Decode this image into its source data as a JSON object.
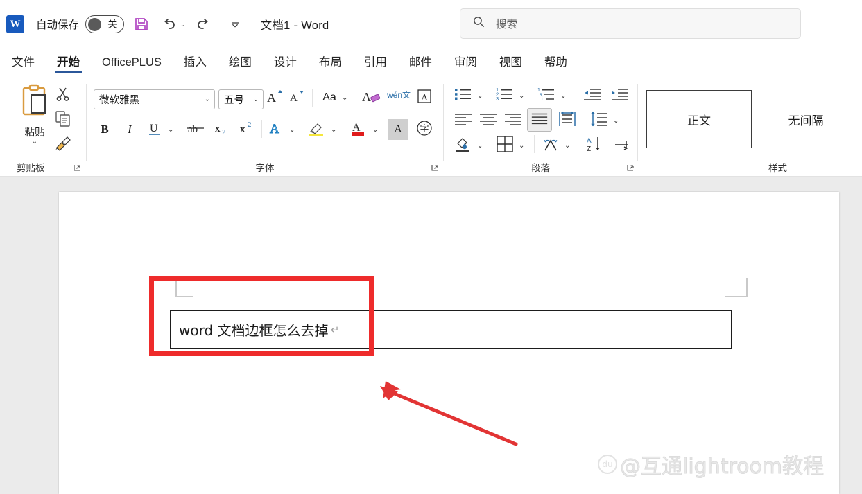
{
  "titlebar": {
    "app_logo": "W",
    "autosave_label": "自动保存",
    "autosave_state": "关",
    "save_icon": "save-icon",
    "undo_icon": "undo-icon",
    "redo_icon": "redo-icon",
    "customize_qat_icon": "chevron-down-icon",
    "document_title": "文档1  -  Word"
  },
  "search": {
    "icon": "search-icon",
    "placeholder": "搜索"
  },
  "tabs": [
    {
      "label": "文件",
      "active": false
    },
    {
      "label": "开始",
      "active": true
    },
    {
      "label": "OfficePLUS",
      "active": false
    },
    {
      "label": "插入",
      "active": false
    },
    {
      "label": "绘图",
      "active": false
    },
    {
      "label": "设计",
      "active": false
    },
    {
      "label": "布局",
      "active": false
    },
    {
      "label": "引用",
      "active": false
    },
    {
      "label": "邮件",
      "active": false
    },
    {
      "label": "审阅",
      "active": false
    },
    {
      "label": "视图",
      "active": false
    },
    {
      "label": "帮助",
      "active": false
    }
  ],
  "ribbon": {
    "clipboard": {
      "group_label": "剪贴板",
      "paste_label": "粘贴",
      "paste_caret": "⌄",
      "cut_icon": "scissors-icon",
      "copy_icon": "copy-icon",
      "format_painter_icon": "format-painter-icon",
      "launcher_icon": "dialog-launcher-icon"
    },
    "font": {
      "group_label": "字体",
      "font_name": "微软雅黑",
      "font_size": "五号",
      "grow_font_icon": "grow-font-icon",
      "shrink_font_icon": "shrink-font-icon",
      "change_case_label": "Aa",
      "clear_format_icon": "clear-formatting-icon",
      "phonetic_guide_label": "wén文",
      "char_border_label": "A",
      "bold_label": "B",
      "italic_label": "I",
      "underline_label": "U",
      "strikethrough_label": "ab",
      "subscript_label": "x₂",
      "superscript_label": "x²",
      "text_effects_label": "A",
      "highlight_icon": "highlighter-icon",
      "font_color_label": "A",
      "char_shading_label": "A",
      "enclose_char_label": "字",
      "launcher_icon": "dialog-launcher-icon"
    },
    "paragraph": {
      "group_label": "段落",
      "bullets_icon": "bullet-list-icon",
      "numbering_icon": "numbered-list-icon",
      "multilevel_icon": "multilevel-list-icon",
      "decrease_indent_icon": "decrease-indent-icon",
      "increase_indent_icon": "increase-indent-icon",
      "align_left_icon": "align-left-icon",
      "align_center_icon": "align-center-icon",
      "align_right_icon": "align-right-icon",
      "align_justify_icon": "align-justify-icon",
      "distribute_icon": "distribute-text-icon",
      "line_spacing_icon": "line-spacing-icon",
      "shading_icon": "shading-icon",
      "borders_icon": "borders-icon",
      "asian_layout_icon": "asian-layout-icon",
      "sort_icon": "sort-az-icon",
      "show_marks_icon": "show-formatting-marks-icon",
      "launcher_icon": "dialog-launcher-icon",
      "active_alignment": "align-justify"
    },
    "styles": {
      "group_label": "样式",
      "items": [
        {
          "label": "正文",
          "selected": true
        },
        {
          "label": "无间隔",
          "selected": false
        }
      ]
    }
  },
  "document": {
    "textbox_content": "word 文档边框怎么去掉",
    "paragraph_mark": "↵",
    "annotation_box_color": "#ee2b2b",
    "annotation_arrow_color": "#e23434"
  },
  "watermark": {
    "paw_icon": "baidu-paw-icon",
    "text": "@互通lightroom教程"
  }
}
